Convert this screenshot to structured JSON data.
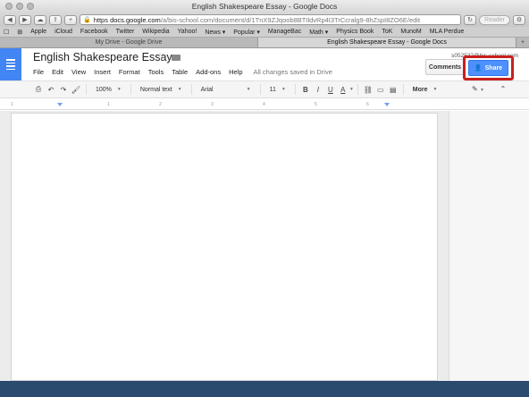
{
  "window": {
    "title": "English Shakespeare Essay - Google Docs"
  },
  "toolbar": {
    "url_scheme": "https",
    "url_host": "docs.google.com",
    "url_path": "/a/bis-school.com/document/d/1TnX9ZJqoob8BTIldvRp4I3TrCcralg9-8hZspI8ZO6E/edit",
    "reader_label": "Reader"
  },
  "bookmarks": [
    "Apple",
    "iCloud",
    "Facebook",
    "Twitter",
    "Wikipedia",
    "Yahoo!",
    "News ▾",
    "Popular ▾",
    "ManageBac",
    "Math ▾",
    "Physics Book",
    "ToK",
    "MunoM",
    "MLA Perdue"
  ],
  "tabs": [
    {
      "label": "My Drive - Google Drive",
      "active": false
    },
    {
      "label": "English Shakespeare Essay - Google Docs",
      "active": true
    }
  ],
  "doc": {
    "title": "English Shakespeare Essay",
    "user_email": "s052532@bis-school.com",
    "comments_label": "Comments",
    "share_label": "Share",
    "save_status": "All changes saved in Drive"
  },
  "menu": [
    "File",
    "Edit",
    "View",
    "Insert",
    "Format",
    "Tools",
    "Table",
    "Add-ons",
    "Help"
  ],
  "format": {
    "zoom": "100%",
    "style": "Normal text",
    "font": "Arial",
    "size": "11",
    "bold": "B",
    "italic": "I",
    "underline": "U",
    "text_color": "A",
    "more": "More"
  },
  "ruler_numbers": [
    "1",
    "1",
    "2",
    "3",
    "4",
    "5",
    "6"
  ],
  "colors": {
    "docs_blue": "#4285f4",
    "share_blue": "#4d90fe",
    "highlight_red": "#c8201c"
  }
}
